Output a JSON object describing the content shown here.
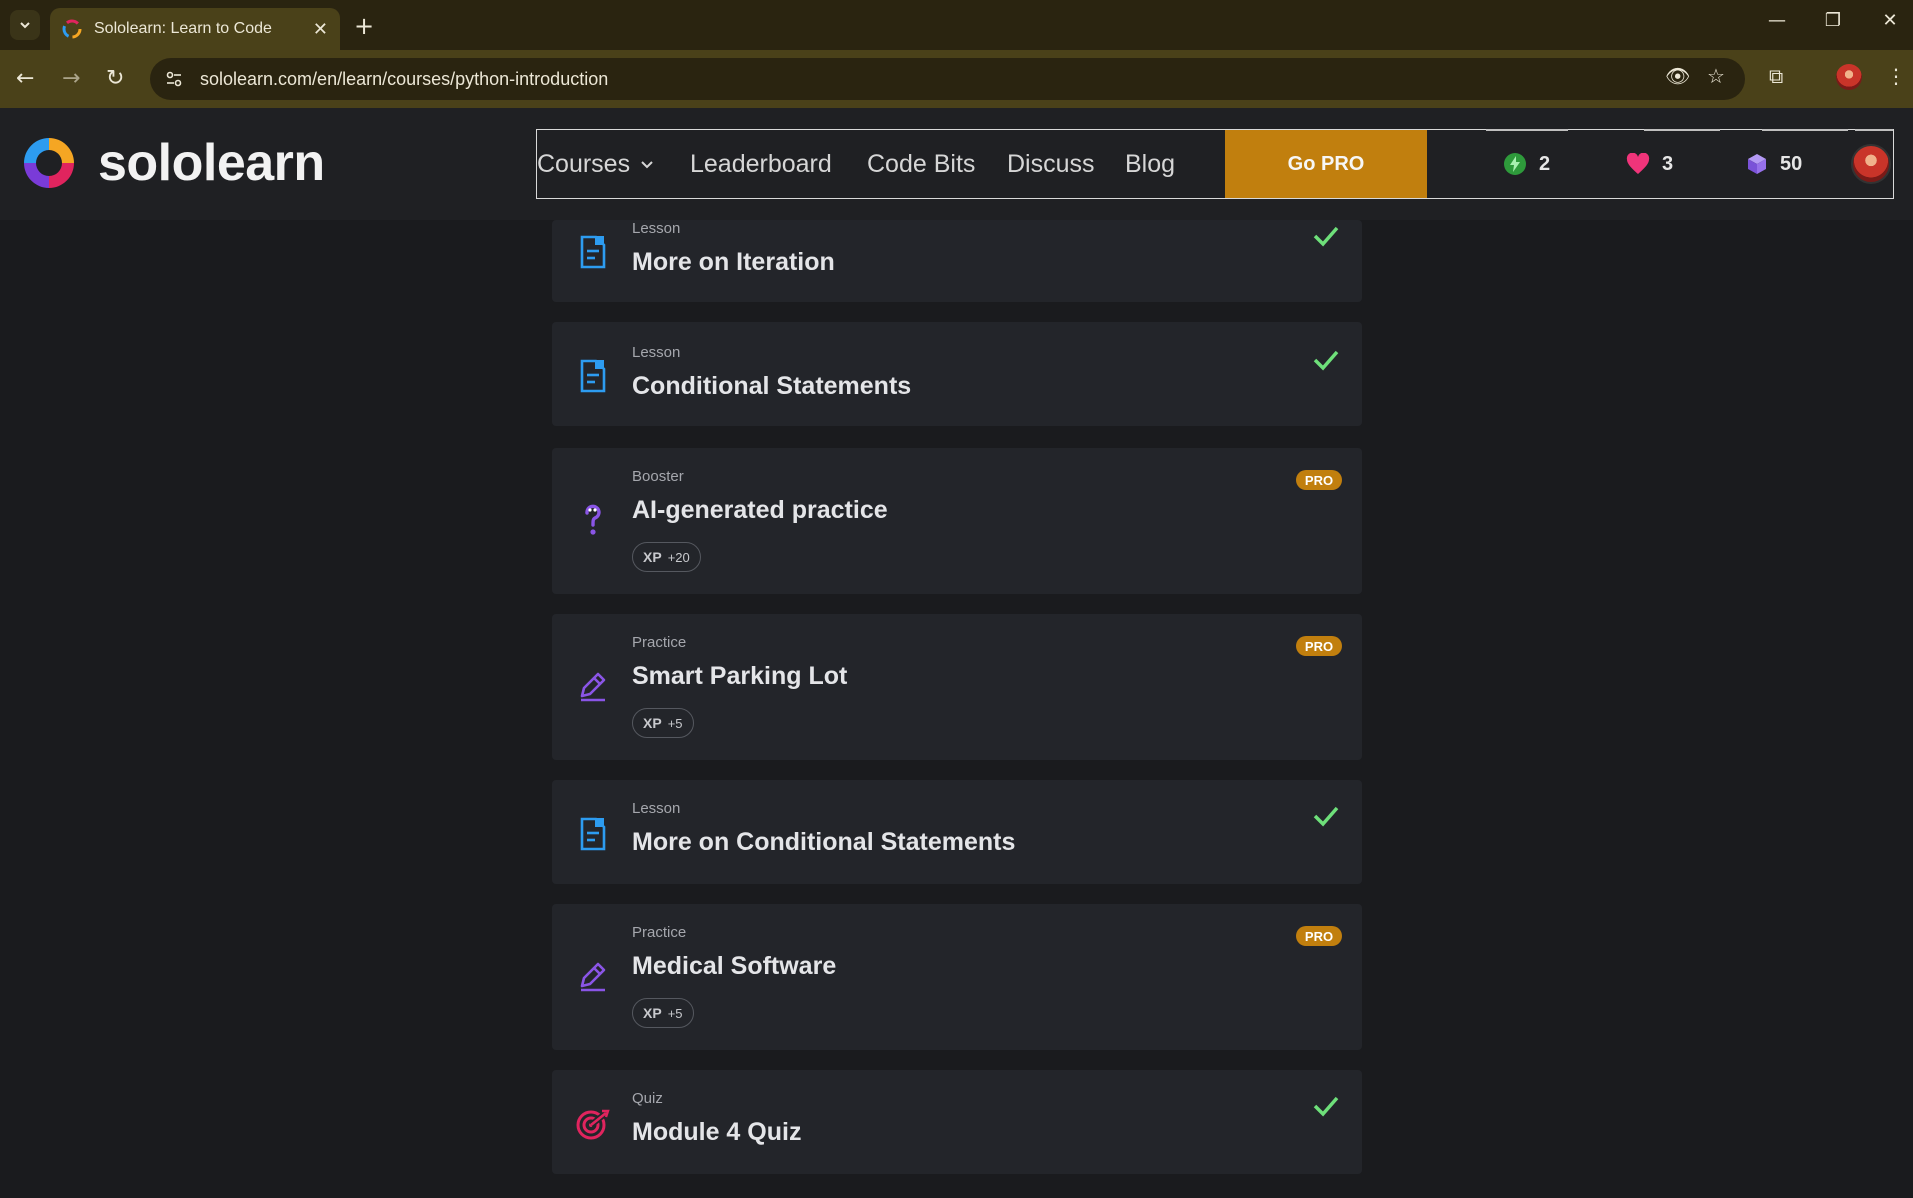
{
  "browser": {
    "tab_title": "Sololearn: Learn to Code",
    "url": "sololearn.com/en/learn/courses/python-introduction"
  },
  "header": {
    "logo_text": "sololearn",
    "nav": {
      "courses": "Courses",
      "leaderboard": "Leaderboard",
      "code_bits": "Code Bits",
      "discuss": "Discuss",
      "blog": "Blog"
    },
    "go_pro": "Go PRO",
    "stats": {
      "streak": "2",
      "hearts": "3",
      "gems": "50"
    }
  },
  "colors": {
    "pro_accent": "#c17f0e",
    "check_green": "#6ee07a",
    "lesson_blue": "#2d9cf0",
    "practice_purple": "#8a55e6",
    "quiz_pink": "#e0245e"
  },
  "items": [
    {
      "type": "Lesson",
      "title": "More on Iteration",
      "icon": "lesson-icon",
      "status": "completed"
    },
    {
      "type": "Lesson",
      "title": "Conditional Statements",
      "icon": "lesson-icon",
      "status": "completed"
    },
    {
      "type": "Booster",
      "title": "AI-generated practice",
      "icon": "question-icon",
      "status": "pro",
      "badge": "PRO",
      "xp_label": "XP",
      "xp_value": "+20"
    },
    {
      "type": "Practice",
      "title": "Smart Parking Lot",
      "icon": "pencil-icon",
      "status": "pro",
      "badge": "PRO",
      "xp_label": "XP",
      "xp_value": "+5"
    },
    {
      "type": "Lesson",
      "title": "More on Conditional Statements",
      "icon": "lesson-icon",
      "status": "completed"
    },
    {
      "type": "Practice",
      "title": "Medical Software",
      "icon": "pencil-icon",
      "status": "pro",
      "badge": "PRO",
      "xp_label": "XP",
      "xp_value": "+5"
    },
    {
      "type": "Quiz",
      "title": "Module 4 Quiz",
      "icon": "target-icon",
      "status": "completed"
    }
  ]
}
